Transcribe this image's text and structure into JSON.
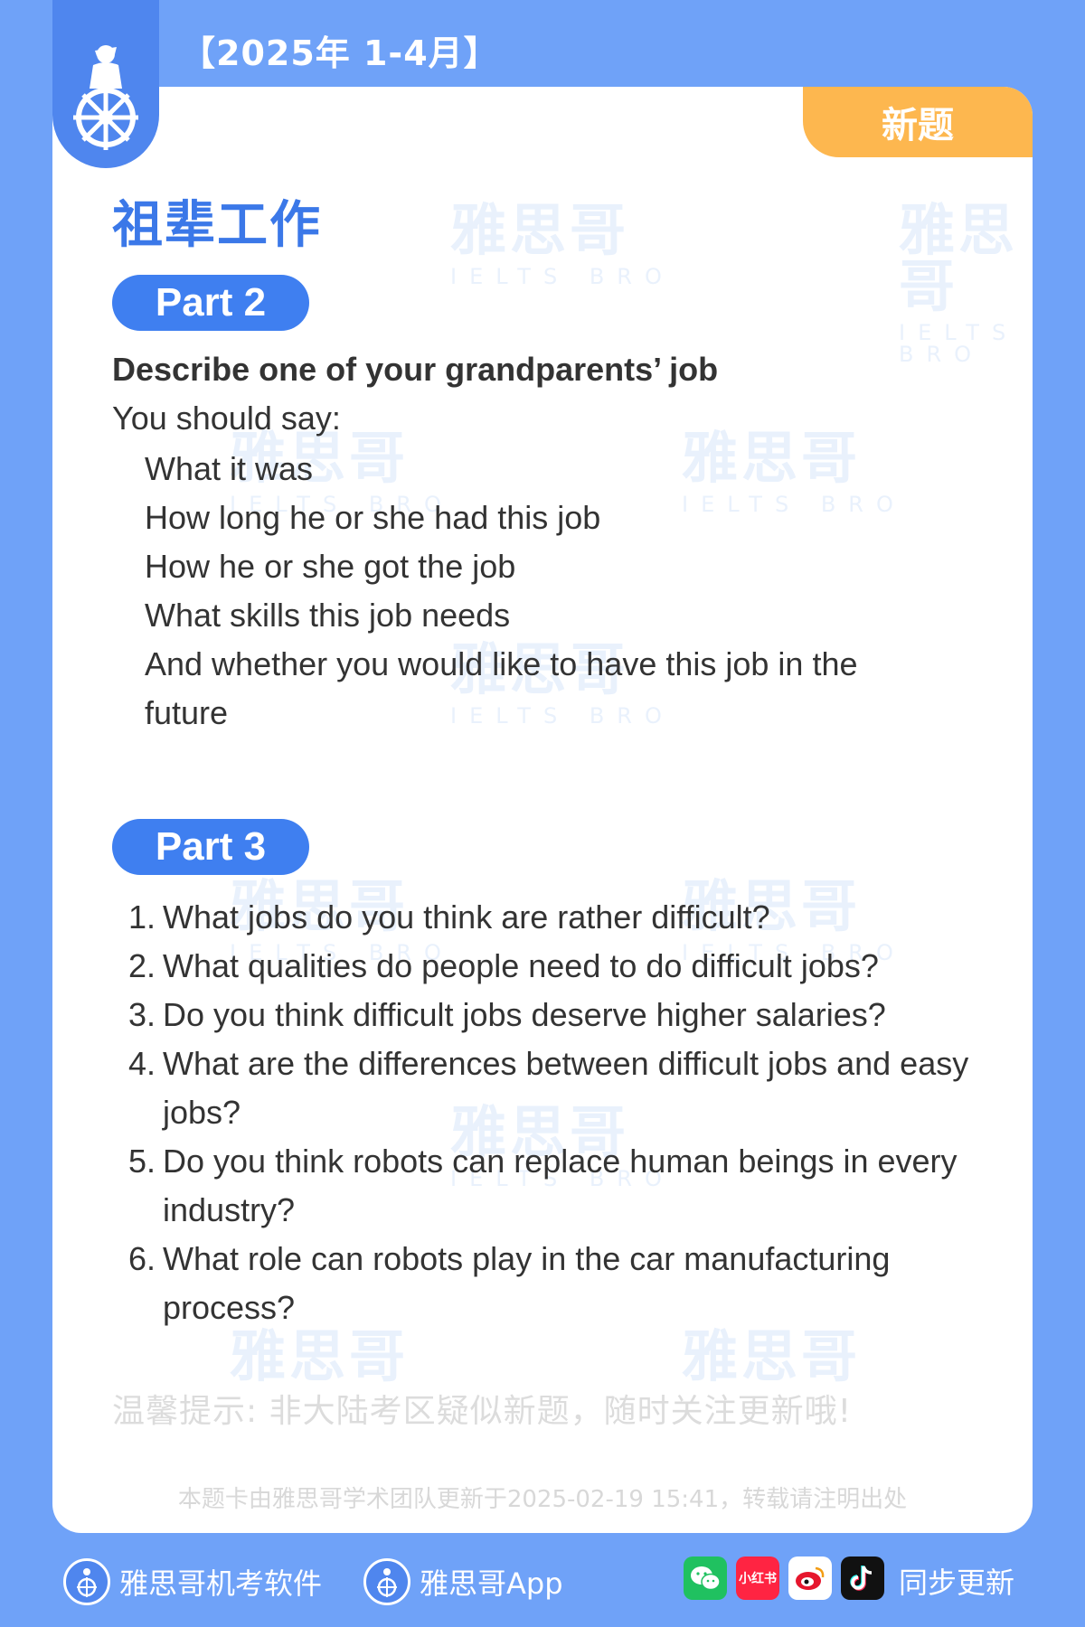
{
  "header": {
    "date_range": "【2025年 1-4月】",
    "new_badge": "新题"
  },
  "watermark": {
    "brand": "雅思哥",
    "sub": "IELTS BRO"
  },
  "topic": {
    "title": "祖辈工作"
  },
  "part2": {
    "label": "Part 2",
    "title": "Describe one of your grandparents’ job",
    "lead": "You should say:",
    "points": [
      "What it was",
      "How long he or she had this job",
      "How he or she got the job",
      "What skills this job needs",
      "And whether you would like to have this job in the future"
    ]
  },
  "part3": {
    "label": "Part 3",
    "questions": [
      {
        "num": "1.",
        "text": "What jobs do you think are rather difficult?"
      },
      {
        "num": "2.",
        "text": "What qualities do people need to do difficult jobs?"
      },
      {
        "num": "3.",
        "text": "Do you think difficult jobs deserve higher salaries?"
      },
      {
        "num": "4.",
        "text": "What are the differences between difficult jobs and easy jobs?"
      },
      {
        "num": "5.",
        "text": "Do you think robots can replace human beings in every industry?"
      },
      {
        "num": "6.",
        "text": "What role can robots play in the car manufacturing process?"
      }
    ]
  },
  "tip": "温馨提示: 非大陆考区疑似新题，随时关注更新哦!",
  "credit": "本题卡由雅思哥学术团队更新于2025-02-19 15:41，转载请注明出处",
  "footer": {
    "software_label": "雅思哥机考软件",
    "app_label": "雅思哥App",
    "social": [
      {
        "name": "wechat-icon",
        "color": "#20c160",
        "glyph": ""
      },
      {
        "name": "xiaohongshu-icon",
        "color": "#ff2442",
        "glyph": "小红书"
      },
      {
        "name": "weibo-icon",
        "color": "#ffffff",
        "glyph": ""
      },
      {
        "name": "douyin-icon",
        "color": "#111111",
        "glyph": ""
      }
    ],
    "sync_label": "同步更新"
  },
  "colors": {
    "background": "#6fa2f8",
    "accent_blue": "#3f7ff0",
    "badge_orange": "#fdb74f"
  }
}
